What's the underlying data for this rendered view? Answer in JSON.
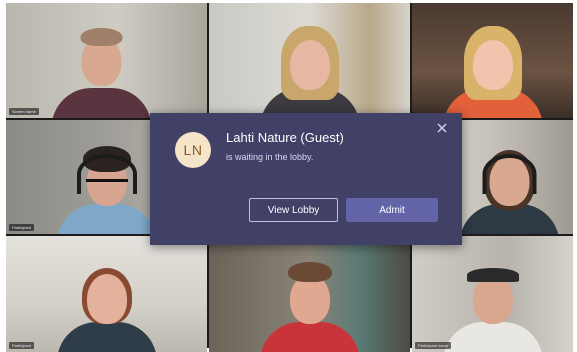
{
  "dialog": {
    "avatar_initials": "LN",
    "guest_name": "Lahti Nature (Guest)",
    "message": "is waiting in the lobby.",
    "view_lobby_label": "View Lobby",
    "admit_label": "Admit",
    "close_icon": "close-icon"
  },
  "colors": {
    "dialog_bg": "#414168",
    "admit_bg": "#6264a7",
    "avatar_bg": "#f5e4c8",
    "avatar_text": "#8a5a22"
  },
  "participants": [
    {
      "tag": "Screen name"
    },
    {
      "tag": ""
    },
    {
      "tag": ""
    },
    {
      "tag": "Participant"
    },
    {
      "tag": ""
    },
    {
      "tag": ""
    },
    {
      "tag": "Participant"
    },
    {
      "tag": ""
    },
    {
      "tag": "Participant name"
    }
  ]
}
